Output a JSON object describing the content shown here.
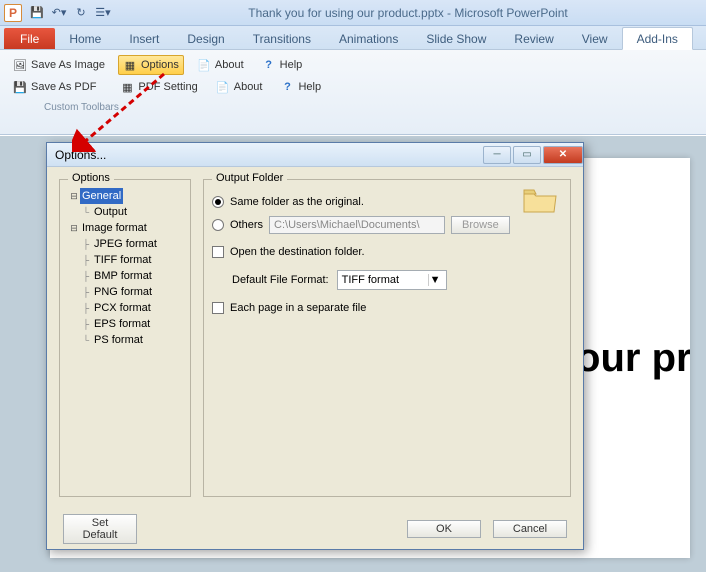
{
  "app_icon_letter": "P",
  "window_title": "Thank you for using our product.pptx - Microsoft PowerPoint",
  "ribbon": {
    "file": "File",
    "tabs": [
      "Home",
      "Insert",
      "Design",
      "Transitions",
      "Animations",
      "Slide Show",
      "Review",
      "View",
      "Add-Ins"
    ],
    "active_tab_index": 8,
    "row1": {
      "save_image": "Save As Image",
      "options": "Options",
      "about": "About",
      "help": "Help"
    },
    "row2": {
      "save_pdf": "Save As PDF",
      "pdf_setting": "PDF Setting",
      "about": "About",
      "help": "Help"
    },
    "group_label": "Custom Toolbars"
  },
  "slide": {
    "text_fragment": "g our pro"
  },
  "dialog": {
    "title": "Options...",
    "left_legend": "Options",
    "right_legend": "Output Folder",
    "tree": {
      "general": "General",
      "output": "Output",
      "image_format": "Image format",
      "formats": [
        "JPEG format",
        "TIFF format",
        "BMP format",
        "PNG format",
        "PCX format",
        "EPS format",
        "PS format"
      ]
    },
    "right": {
      "same_folder": "Same folder as the original.",
      "others": "Others",
      "path_value": "C:\\Users\\Michael\\Documents\\",
      "browse": "Browse",
      "open_dest": "Open the destination folder.",
      "default_format_label": "Default File Format:",
      "default_format_value": "TIFF format",
      "each_page": "Each page in a separate file"
    },
    "footer": {
      "set_default": "Set Default",
      "ok": "OK",
      "cancel": "Cancel"
    }
  }
}
